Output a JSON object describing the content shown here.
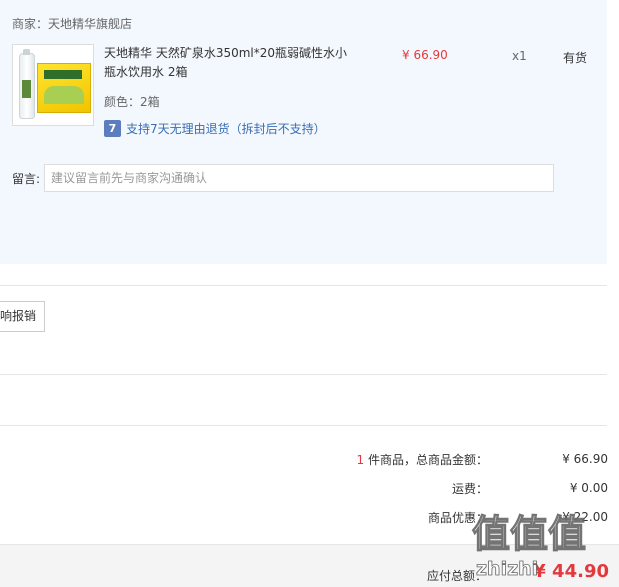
{
  "shop": {
    "name": "商家：天地精华旗舰店",
    "item": {
      "title": "天地精华 天然矿泉水350ml*20瓶弱碱性水小瓶水饮用水 2箱",
      "price": "¥ 66.90",
      "qty": "x1",
      "stock": "有货",
      "color": "颜色：2箱",
      "return_badge": "7",
      "return_text": "支持7天无理由退货（拆封后不支持）"
    },
    "remark_label": "留言:",
    "remark_placeholder": "建议留言前先与商家沟通确认"
  },
  "reimburse_button": "响报销",
  "summary": {
    "count": "1",
    "count_suffix": " 件商品，总商品金额：",
    "goods_total": "¥ 66.90",
    "shipping_label": "运费：",
    "shipping_value": "¥ 0.00",
    "discount_label": "商品优惠：",
    "discount_value": "-¥ 22.00"
  },
  "footer": {
    "pay_label": "应付总额：",
    "pay_value": "¥ 44.90"
  },
  "watermark": {
    "glyphs": "值值值",
    "site": "zhizhi"
  },
  "colors": {
    "accent_red": "#e4393c",
    "panel_bg": "#f3f8fe",
    "link_blue": "#3b6db3"
  }
}
